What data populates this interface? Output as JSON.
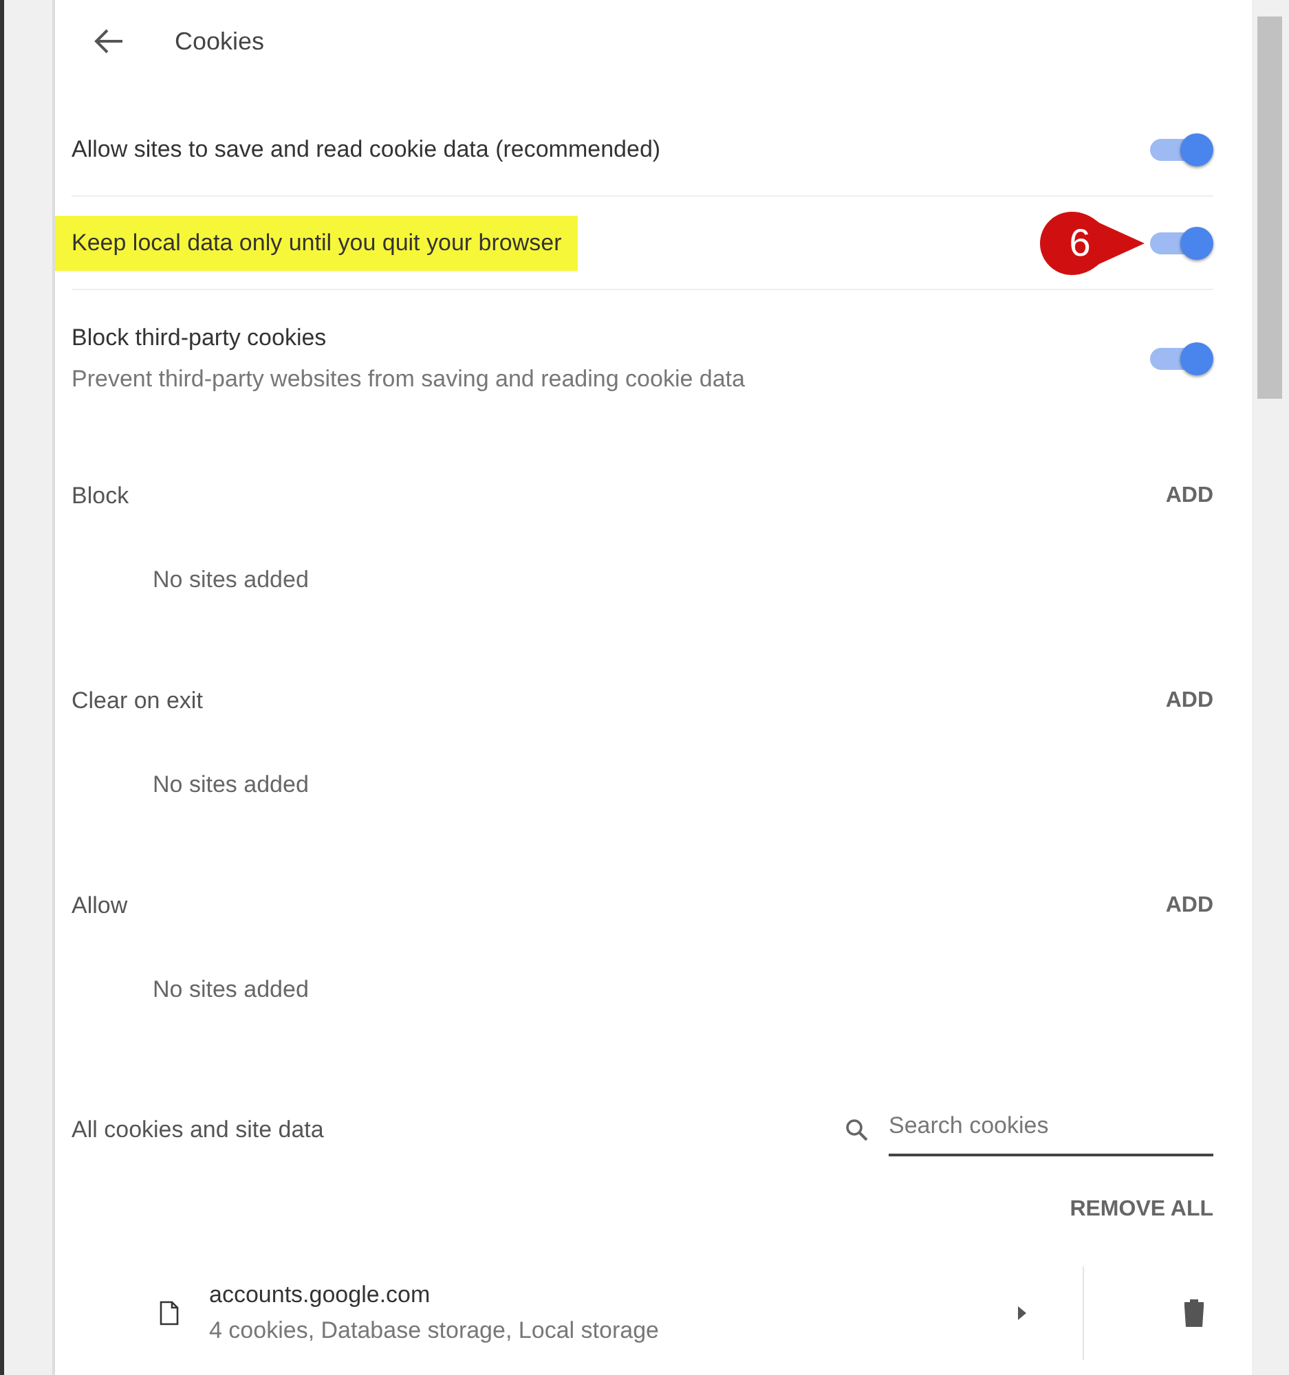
{
  "header": {
    "title": "Cookies"
  },
  "toggles": [
    {
      "label": "Allow sites to save and read cookie data (recommended)",
      "on": true,
      "highlighted": false
    },
    {
      "label": "Keep local data only until you quit your browser",
      "on": true,
      "highlighted": true,
      "callout": "6"
    },
    {
      "label": "Block third-party cookies",
      "description": "Prevent third-party websites from saving and reading cookie data",
      "on": true,
      "highlighted": false
    }
  ],
  "site_lists": [
    {
      "title": "Block",
      "action": "ADD",
      "empty_text": "No sites added"
    },
    {
      "title": "Clear on exit",
      "action": "ADD",
      "empty_text": "No sites added"
    },
    {
      "title": "Allow",
      "action": "ADD",
      "empty_text": "No sites added"
    }
  ],
  "all_cookies": {
    "title": "All cookies and site data",
    "search": {
      "placeholder": "Search cookies"
    },
    "remove_all": "REMOVE ALL",
    "sites": [
      {
        "name": "accounts.google.com",
        "details": "4 cookies, Database storage, Local storage"
      }
    ]
  }
}
